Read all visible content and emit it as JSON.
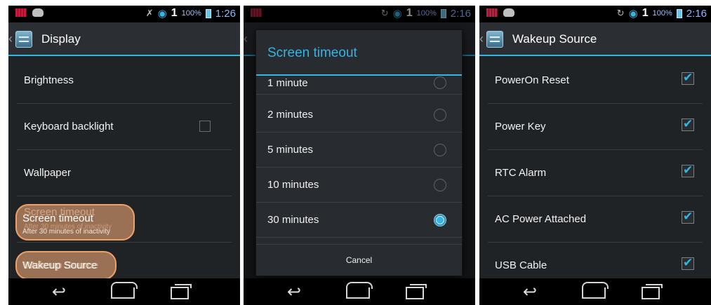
{
  "screens": [
    {
      "statusbar": {
        "battery": "100%",
        "time": "1:26",
        "signal": "1"
      },
      "actionbar": {
        "title": "Display"
      },
      "settings": [
        {
          "title": "Brightness"
        },
        {
          "title": "Keyboard backlight"
        },
        {
          "title": "Wallpaper"
        },
        {
          "title": "Screen timeout",
          "subtitle": "After 30 minutes of inactivity"
        },
        {
          "title": "Wakeup Source"
        }
      ]
    },
    {
      "statusbar": {
        "battery": "100%",
        "time": "2:16",
        "signal": "1"
      },
      "dialog": {
        "title": "Screen timeout",
        "options": [
          {
            "label": "1 minute"
          },
          {
            "label": "2 minutes"
          },
          {
            "label": "5 minutes"
          },
          {
            "label": "10 minutes"
          },
          {
            "label": "30 minutes"
          }
        ],
        "cancel": "Cancel"
      }
    },
    {
      "statusbar": {
        "battery": "100%",
        "time": "2:16",
        "signal": "1"
      },
      "actionbar": {
        "title": "Wakeup Source"
      },
      "sources": [
        {
          "label": "PowerOn Reset"
        },
        {
          "label": "Power Key"
        },
        {
          "label": "RTC Alarm"
        },
        {
          "label": "AC Power Attached"
        },
        {
          "label": "USB Cable"
        }
      ]
    }
  ]
}
